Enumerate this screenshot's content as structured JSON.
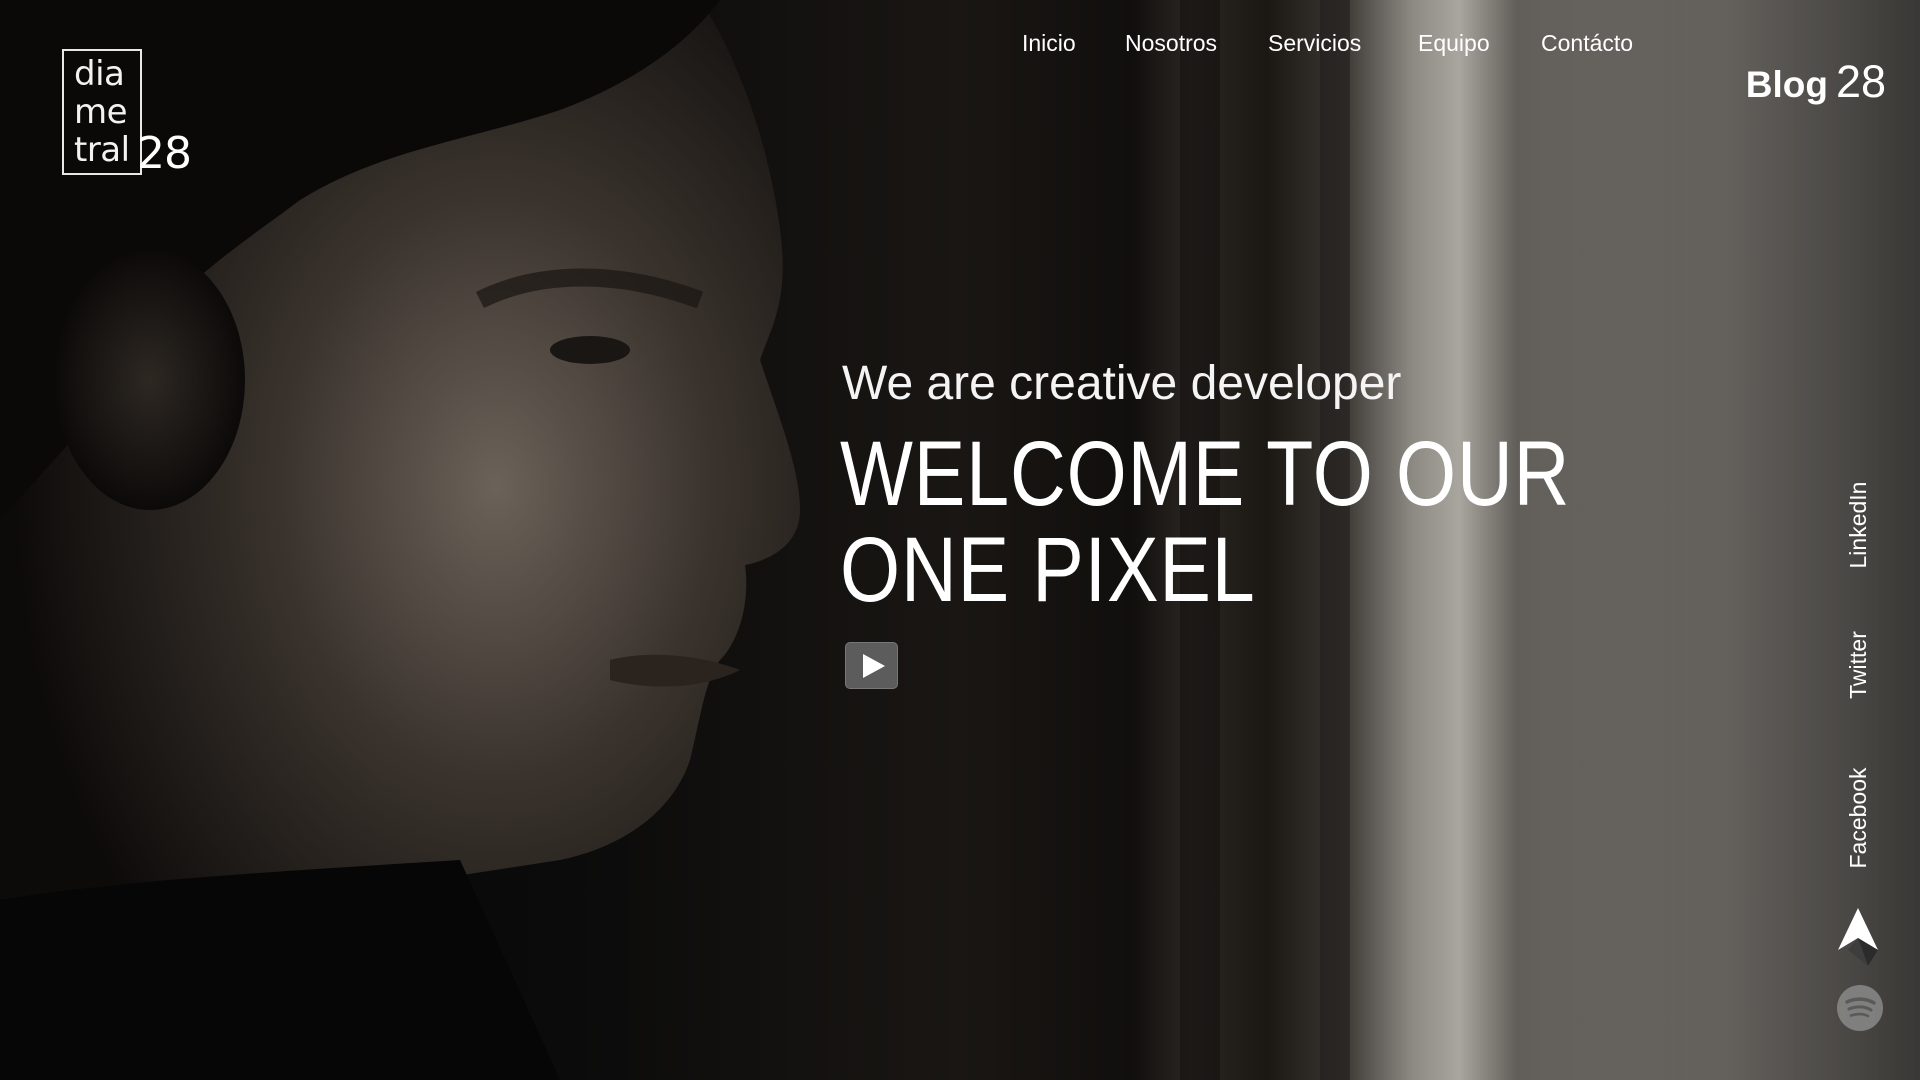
{
  "logo": {
    "line1": "dia",
    "line2": "me",
    "line3": "tral",
    "number": "28"
  },
  "nav": {
    "items": [
      {
        "label": "Inicio"
      },
      {
        "label": "Nosotros"
      },
      {
        "label": "Servicios"
      },
      {
        "label": "Equipo"
      },
      {
        "label": "Contácto"
      }
    ]
  },
  "blog": {
    "word": "Blog",
    "number": "28"
  },
  "hero": {
    "tagline": "We are creative developer",
    "title_line1": "WELCOME TO OUR",
    "title_line2": "ONE PIXEL",
    "play_icon": "play-icon"
  },
  "social": {
    "links": [
      {
        "label": "LinkedIn"
      },
      {
        "label": "Twitter"
      },
      {
        "label": "Facebook"
      }
    ],
    "icons": [
      "up-arrow-icon",
      "spotify-icon"
    ]
  },
  "colors": {
    "text": "#ffffff",
    "play_button_bg": "#5c5c5c",
    "background_dark": "#070707",
    "background_light": "#a9a59f"
  }
}
